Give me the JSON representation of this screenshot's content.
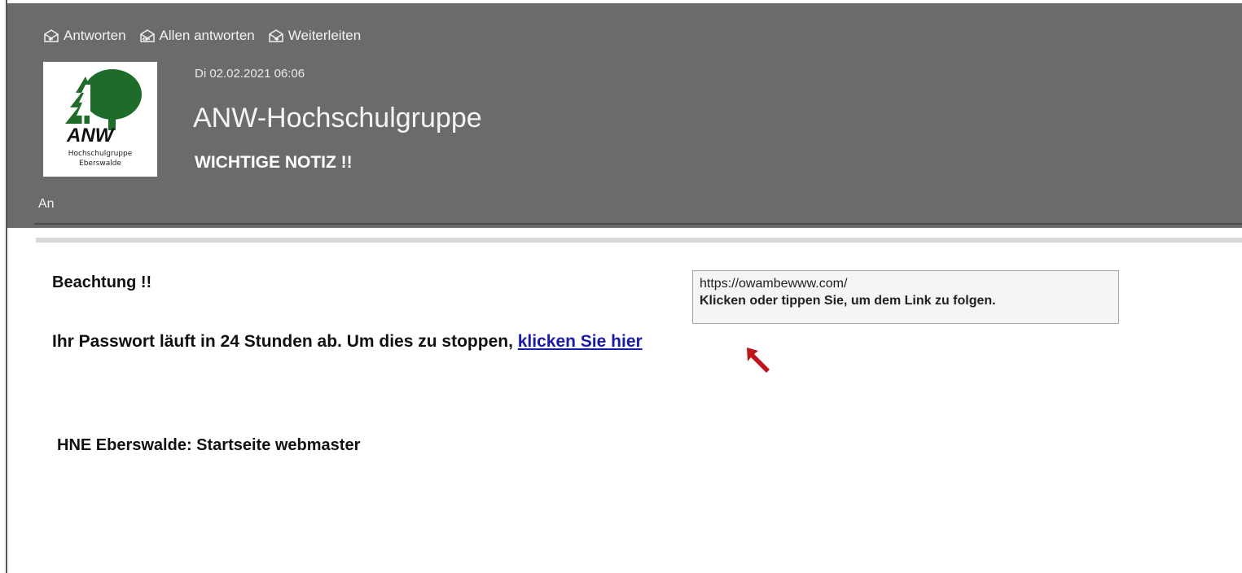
{
  "toolbar": {
    "reply_label": "Antworten",
    "reply_all_label": "Allen antworten",
    "forward_label": "Weiterleiten"
  },
  "logo": {
    "mark": "ANW",
    "line1": "Hochschulgruppe",
    "line2": "Eberswalde"
  },
  "message": {
    "date": "Di 02.02.2021 06:06",
    "sender": "ANW-Hochschulgruppe",
    "subject": "WICHTIGE NOTIZ !!",
    "to_label": "An"
  },
  "body": {
    "heading": "Beachtung !!",
    "text_before_link": "Ihr Passwort läuft in 24 Stunden ab. Um dies zu stoppen, ",
    "link_text": "klicken Sie hier",
    "signature": "HNE Eberswalde: Startseite webmaster"
  },
  "tooltip": {
    "url": "https://owambewww.com/",
    "hint": "Klicken oder tippen Sie, um dem Link zu folgen."
  },
  "colors": {
    "header_bg": "#6b6b6b",
    "link": "#1a1aa8",
    "logo_green": "#1e6b2a",
    "cursor": "#c0141c"
  }
}
